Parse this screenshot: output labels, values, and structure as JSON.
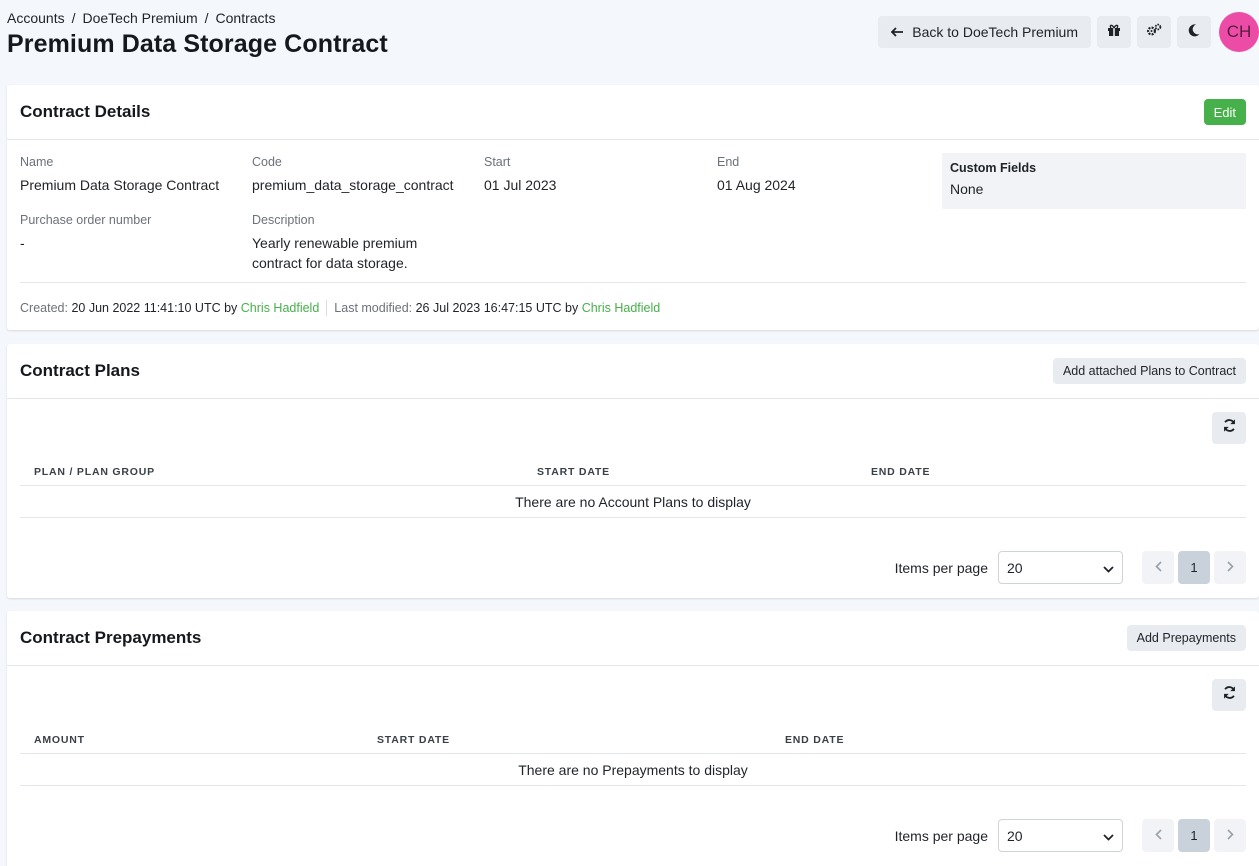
{
  "breadcrumb": [
    "Accounts",
    "DoeTech Premium",
    "Contracts"
  ],
  "page_title": "Premium Data Storage Contract",
  "header": {
    "back_label": "Back to DoeTech Premium",
    "avatar_initials": "CH"
  },
  "details": {
    "title": "Contract Details",
    "edit_label": "Edit",
    "name_label": "Name",
    "name_value": "Premium Data Storage Contract",
    "code_label": "Code",
    "code_value": "premium_data_storage_contract",
    "start_label": "Start",
    "start_value": "01 Jul 2023",
    "end_label": "End",
    "end_value": "01 Aug 2024",
    "po_label": "Purchase order number",
    "po_value": "-",
    "desc_label": "Description",
    "desc_line1": "Yearly renewable premium",
    "desc_line2": "contract for data storage.",
    "custom_title": "Custom Fields",
    "custom_value": "None",
    "created_label": "Created:",
    "created_value": "20 Jun 2022 11:41:10 UTC by",
    "created_by": "Chris Hadfield",
    "modified_label": "Last modified:",
    "modified_value": "26 Jul 2023 16:47:15 UTC by",
    "modified_by": "Chris Hadfield"
  },
  "plans": {
    "title": "Contract Plans",
    "add_label": "Add attached Plans to Contract",
    "col1": "PLAN / PLAN GROUP",
    "col2": "START DATE",
    "col3": "END DATE",
    "empty": "There are no Account Plans to display",
    "ipp_label": "Items per page",
    "ipp_value": "20",
    "page": "1"
  },
  "prepayments": {
    "title": "Contract Prepayments",
    "add_label": "Add Prepayments",
    "col1": "AMOUNT",
    "col2": "START DATE",
    "col3": "END DATE",
    "empty": "There are no Prepayments to display",
    "ipp_label": "Items per page",
    "ipp_value": "20",
    "page": "1"
  },
  "colors": {
    "accent_green": "#46b04a",
    "avatar_pink": "#ec4ba6"
  }
}
